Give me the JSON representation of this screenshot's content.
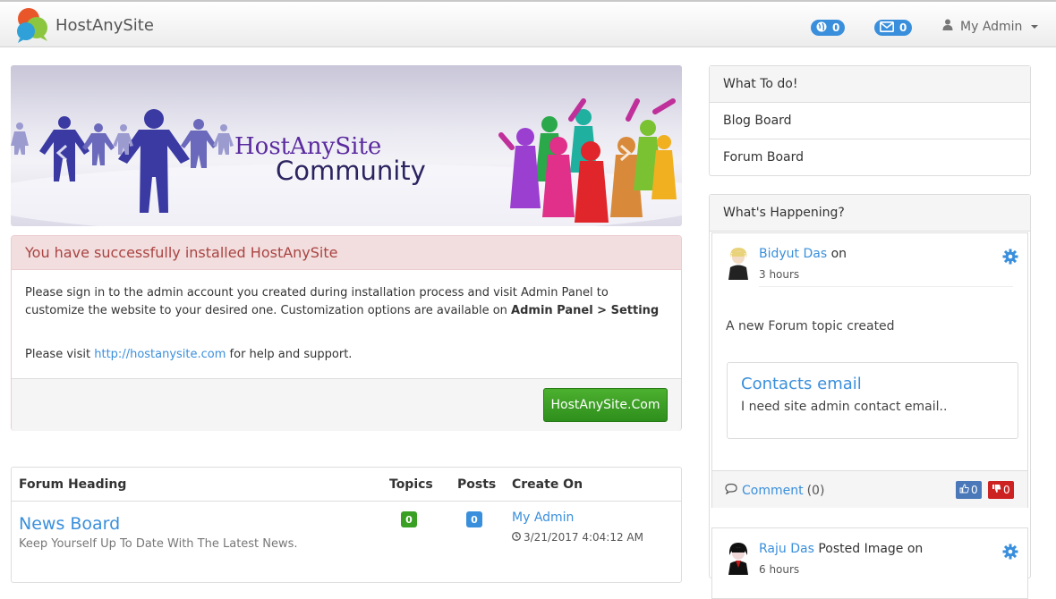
{
  "navbar": {
    "brand": "HostAnySite",
    "notifications_count": "0",
    "messages_count": "0",
    "user_label": "My Admin"
  },
  "banner": {
    "title_line1": "HostAnySite",
    "title_line2": "Community"
  },
  "alert": {
    "heading": "You have successfully installed HostAnySite",
    "body_line1": "Please sign in to the admin account you created during installation process and visit Admin Panel to customize the website to your desired one. Customization options are available on ",
    "body_bold": "Admin Panel > Setting",
    "visit_prefix": "Please visit ",
    "visit_link": "http://hostanysite.com",
    "visit_suffix": " for help and support.",
    "button_label": "HostAnySite.Com"
  },
  "forum": {
    "columns": [
      "Forum Heading",
      "Topics",
      "Posts",
      "Create On"
    ],
    "rows": [
      {
        "title": "News Board",
        "description": "Keep Yourself Up To Date With The Latest News.",
        "topics": "0",
        "posts": "0",
        "author": "My Admin",
        "date": "3/21/2017 4:04:12 AM"
      }
    ]
  },
  "todo": {
    "heading": "What To do!",
    "items": [
      "Blog Board",
      "Forum Board"
    ]
  },
  "happening": {
    "heading": "What's Happening?",
    "feed": [
      {
        "user": "Bidyut Das",
        "suffix": " on",
        "time": "3 hours",
        "text": "A new Forum topic created",
        "topic_title": "Contacts email",
        "topic_text": "I need site admin contact email..",
        "comment_label": "Comment",
        "comment_count": "(0)",
        "likes": "0",
        "dislikes": "0"
      },
      {
        "user": "Raju Das",
        "suffix": " Posted Image on",
        "time": "6 hours"
      }
    ]
  },
  "colors": {
    "link": "#3a8fdc",
    "alert_text": "#a94442",
    "success_button": "#3aa024",
    "like": "#4a78b8",
    "dislike": "#cc2222"
  }
}
